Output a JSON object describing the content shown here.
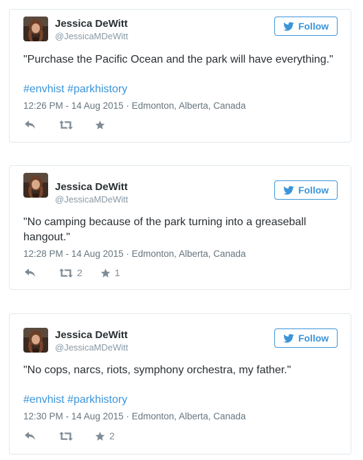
{
  "colors": {
    "link": "#3b94d9",
    "meta": "#66757f",
    "action_icon": "#7e8b95",
    "border": "#e1e8ed"
  },
  "tweets": [
    {
      "name": "Jessica DeWitt",
      "handle": "@JessicaMDeWitt",
      "follow_label": "Follow",
      "text": "\"Purchase the Pacific Ocean and the park will have everything.\"",
      "hashtags": [
        "#envhist",
        "#parkhistory"
      ],
      "time": "12:26 PM - 14 Aug 2015",
      "separator": "·",
      "location": "Edmonton, Alberta, Canada",
      "actions": {
        "reply_icon": "reply-icon",
        "retweet_icon": "retweet-icon",
        "favorite_icon": "star-icon",
        "retweet_count": "",
        "favorite_count": ""
      }
    },
    {
      "name": "Jessica DeWitt",
      "handle": "@JessicaMDeWitt",
      "follow_label": "Follow",
      "text": "\"No camping because of the park turning into a greaseball hangout.\"",
      "hashtags": [],
      "time": "12:28 PM - 14 Aug 2015",
      "separator": "·",
      "location": "Edmonton, Alberta, Canada",
      "actions": {
        "reply_icon": "reply-icon",
        "retweet_icon": "retweet-icon",
        "favorite_icon": "star-icon",
        "retweet_count": "2",
        "favorite_count": "1"
      }
    },
    {
      "name": "Jessica DeWitt",
      "handle": "@JessicaMDeWitt",
      "follow_label": "Follow",
      "text": "\"No cops, narcs, riots, symphony orchestra, my father.\"",
      "hashtags": [
        "#envhist",
        "#parkhistory"
      ],
      "time": "12:30 PM - 14 Aug 2015",
      "separator": "·",
      "location": "Edmonton, Alberta, Canada",
      "actions": {
        "reply_icon": "reply-icon",
        "retweet_icon": "retweet-icon",
        "favorite_icon": "star-icon",
        "retweet_count": "",
        "favorite_count": "2"
      }
    }
  ]
}
